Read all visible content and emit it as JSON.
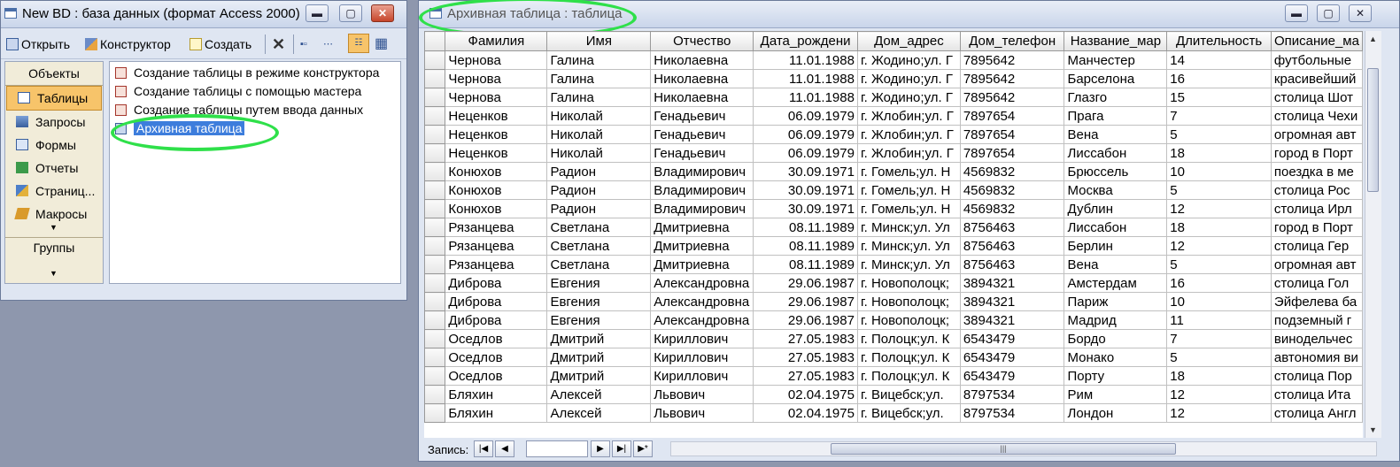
{
  "db_window": {
    "title": "New BD : база данных (формат Access 2000)",
    "controls": {
      "minimize": "▬",
      "maximize": "▢",
      "close": "✕"
    },
    "toolbar": {
      "open": "Открыть",
      "designer": "Конструктор",
      "create": "Создать",
      "delete": "✕"
    },
    "objects": {
      "header": "Объекты",
      "items": [
        {
          "label": "Таблицы",
          "icon": "table-icon",
          "selected": true
        },
        {
          "label": "Запросы",
          "icon": "query-icon"
        },
        {
          "label": "Формы",
          "icon": "form-icon"
        },
        {
          "label": "Отчеты",
          "icon": "report-icon"
        },
        {
          "label": "Страниц...",
          "icon": "page-icon"
        },
        {
          "label": "Макросы",
          "icon": "macro-icon"
        }
      ],
      "groups_header": "Группы"
    },
    "list": [
      {
        "label": "Создание таблицы в режиме конструктора"
      },
      {
        "label": "Создание таблицы с помощью мастера"
      },
      {
        "label": "Создание таблицы путем ввода данных"
      },
      {
        "label": "Архивная таблица",
        "selected": true
      }
    ]
  },
  "table_window": {
    "title": "Архивная таблица : таблица",
    "controls": {
      "minimize": "▬",
      "maximize": "▢",
      "close": "✕"
    },
    "columns": [
      "Фамилия",
      "Имя",
      "Отчество",
      "Дата_рождени",
      "Дом_адрес",
      "Дом_телефон",
      "Название_мар",
      "Длительность",
      "Описание_ма"
    ],
    "rows": [
      [
        "Чернова",
        "Галина",
        "Николаевна",
        "11.01.1988",
        "г. Жодино;ул. Г",
        "7895642",
        "Манчестер",
        "14",
        "футбольные"
      ],
      [
        "Чернова",
        "Галина",
        "Николаевна",
        "11.01.1988",
        "г. Жодино;ул. Г",
        "7895642",
        "Барселона",
        "16",
        "красивейший"
      ],
      [
        "Чернова",
        "Галина",
        "Николаевна",
        "11.01.1988",
        "г. Жодино;ул. Г",
        "7895642",
        "Глазго",
        "15",
        "столица Шот"
      ],
      [
        "Неценков",
        "Николай",
        "Генадьевич",
        "06.09.1979",
        "г. Жлобин;ул. Г",
        "7897654",
        "Прага",
        "7",
        "столица Чехи"
      ],
      [
        "Неценков",
        "Николай",
        "Генадьевич",
        "06.09.1979",
        "г. Жлобин;ул. Г",
        "7897654",
        "Вена",
        "5",
        "огромная авт"
      ],
      [
        "Неценков",
        "Николай",
        "Генадьевич",
        "06.09.1979",
        "г. Жлобин;ул. Г",
        "7897654",
        "Лиссабон",
        "18",
        "город в Порт"
      ],
      [
        "Конюхов",
        "Радион",
        "Владимирович",
        "30.09.1971",
        "г. Гомель;ул. Н",
        "4569832",
        "Брюссель",
        "10",
        "поездка в ме"
      ],
      [
        "Конюхов",
        "Радион",
        "Владимирович",
        "30.09.1971",
        "г. Гомель;ул. Н",
        "4569832",
        "Москва",
        "5",
        "столица Рос"
      ],
      [
        "Конюхов",
        "Радион",
        "Владимирович",
        "30.09.1971",
        "г. Гомель;ул. Н",
        "4569832",
        "Дублин",
        "12",
        "столица Ирл"
      ],
      [
        "Рязанцева",
        "Светлана",
        "Дмитриевна",
        "08.11.1989",
        "г. Минск;ул. Ул",
        "8756463",
        "Лиссабон",
        "18",
        "город в Порт"
      ],
      [
        "Рязанцева",
        "Светлана",
        "Дмитриевна",
        "08.11.1989",
        "г. Минск;ул. Ул",
        "8756463",
        "Берлин",
        "12",
        "столица Гер"
      ],
      [
        "Рязанцева",
        "Светлана",
        "Дмитриевна",
        "08.11.1989",
        "г. Минск;ул. Ул",
        "8756463",
        "Вена",
        "5",
        "огромная авт"
      ],
      [
        "Диброва",
        "Евгения",
        "Александровна",
        "29.06.1987",
        "г. Новополоцк;",
        "3894321",
        "Амстердам",
        "16",
        "столица Гол"
      ],
      [
        "Диброва",
        "Евгения",
        "Александровна",
        "29.06.1987",
        "г. Новополоцк;",
        "3894321",
        "Париж",
        "10",
        "Эйфелева ба"
      ],
      [
        "Диброва",
        "Евгения",
        "Александровна",
        "29.06.1987",
        "г. Новополоцк;",
        "3894321",
        "Мадрид",
        "11",
        "подземный г"
      ],
      [
        "Оседлов",
        "Дмитрий",
        "Кириллович",
        "27.05.1983",
        "г. Полоцк;ул. К",
        "6543479",
        "Бордо",
        "7",
        "винодельчес"
      ],
      [
        "Оседлов",
        "Дмитрий",
        "Кириллович",
        "27.05.1983",
        "г. Полоцк;ул. К",
        "6543479",
        "Монако",
        "5",
        "автономия ви"
      ],
      [
        "Оседлов",
        "Дмитрий",
        "Кириллович",
        "27.05.1983",
        "г. Полоцк;ул. К",
        "6543479",
        "Порту",
        "18",
        "столица Пор"
      ],
      [
        "Бляхин",
        "Алексей",
        "Львович",
        "02.04.1975",
        "г. Вицебск;ул.",
        "8797534",
        "Рим",
        "12",
        "столица Ита"
      ],
      [
        "Бляхин",
        "Алексей",
        "Львович",
        "02.04.1975",
        "г. Вицебск;ул.",
        "8797534",
        "Лондон",
        "12",
        "столица Англ"
      ]
    ],
    "navigation": {
      "label": "Запись:",
      "first": "|◀",
      "prev": "◀",
      "next": "▶",
      "last": "▶|",
      "new": "▶*",
      "record_value": ""
    }
  },
  "colors": {
    "highlight": "#2fe04a",
    "selection": "#3d7ddc",
    "objects_selected": "#f7c46a"
  }
}
